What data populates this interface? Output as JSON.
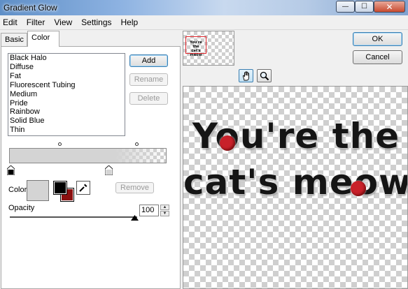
{
  "window": {
    "title": "Gradient Glow"
  },
  "menu": [
    "Edit",
    "Filter",
    "View",
    "Settings",
    "Help"
  ],
  "tabs": {
    "basic": "Basic",
    "color": "Color"
  },
  "presets": [
    "Black Halo",
    "Diffuse",
    "Fat",
    "Fluorescent Tubing",
    "Medium",
    "Pride",
    "Rainbow",
    "Solid Blue",
    "Thin"
  ],
  "buttons": {
    "add": "Add",
    "rename": "Rename",
    "delete": "Delete",
    "remove": "Remove",
    "ok": "OK",
    "cancel": "Cancel"
  },
  "color_label": "Color",
  "opacity": {
    "label": "Opacity",
    "value": "100",
    "slider_fraction": 1.0
  },
  "preview": {
    "line1": "You're the",
    "line2": "cat's meow",
    "thumb_line1": "You're the",
    "thumb_line2": "cat's meow"
  },
  "colors": {
    "accent_red": "#c8212a",
    "swatch_fg": "#000000",
    "swatch_bg": "#8b1010",
    "current_color": "#d4d4d4"
  }
}
